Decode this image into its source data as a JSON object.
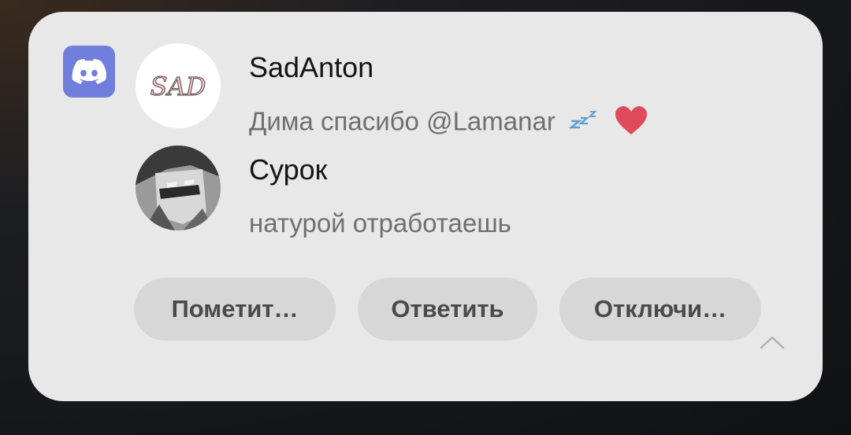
{
  "notification": {
    "app_icon": "discord-icon",
    "messages": [
      {
        "author": "SadAnton",
        "avatar_text": "SAD",
        "text": "Дима спасибо @Lamanar",
        "emojis": [
          "zzz-icon",
          "heart-icon"
        ]
      },
      {
        "author": "Сурок",
        "avatar": "anime-avatar",
        "text": "натурой отработаешь"
      }
    ],
    "actions": [
      {
        "label": "Пометит…"
      },
      {
        "label": "Ответить"
      },
      {
        "label": "Отключи…"
      }
    ],
    "collapse_icon": "chevron-up-icon"
  },
  "colors": {
    "card_bg": "#e8e8e8",
    "discord_blurple": "#6f7fdb",
    "button_bg": "#d7d7d7",
    "heart": "#e04a5a"
  }
}
